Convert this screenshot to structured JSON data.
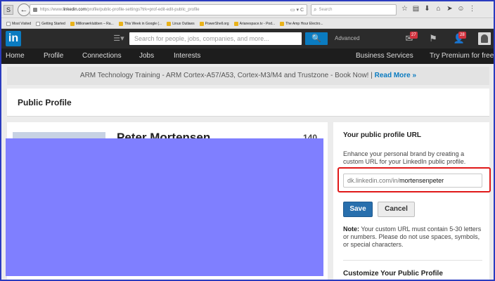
{
  "browser": {
    "s_badge": "S",
    "back_glyph": "←",
    "url_prefix": "https://www.",
    "url_domain": "linkedin.com",
    "url_path": "/profile/public-profile-settings?trk=prof-edit-edit-public_profile",
    "url_right": "▭ ▾ C",
    "search_placeholder": "Search",
    "toolbar_icons": [
      "☆",
      "▤",
      "⬇",
      "⌂",
      "➤",
      "☺",
      "⋮"
    ]
  },
  "bookmarks": [
    {
      "label": "Most Visited",
      "page": true
    },
    {
      "label": "Getting Started",
      "page": true
    },
    {
      "label": "Millionærklubben – Ra...",
      "page": false
    },
    {
      "label": "This Week in Google (...",
      "page": false
    },
    {
      "label": "Linux Outlaws",
      "page": false
    },
    {
      "label": "PowerShell.org",
      "page": false
    },
    {
      "label": "Arianespace.tv - Pod...",
      "page": false
    },
    {
      "label": "The Amp Hour Electro...",
      "page": false
    }
  ],
  "header": {
    "logo": "in",
    "menu_glyph": "☰▾",
    "search_placeholder": "Search for people, jobs, companies, and more...",
    "search_glyph": "🔍",
    "advanced": "Advanced",
    "messages_badge": "27",
    "notifications_badge": "28",
    "icon_messages": "✉",
    "icon_flag": "⚑",
    "icon_people": "👤"
  },
  "nav": {
    "home": "Home",
    "profile": "Profile",
    "connections": "Connections",
    "jobs": "Jobs",
    "interests": "Interests",
    "business": "Business Services",
    "premium": "Try Premium for free"
  },
  "ad": {
    "text": "ARM Technology Training - ARM Cortex-A57/A53, Cortex-M3/M4 and Trustzone - Book Now! | ",
    "link": "Read More »"
  },
  "page": {
    "title": "Public Profile"
  },
  "profile": {
    "name": "Peter Mortensen",
    "connections": "140"
  },
  "public_url": {
    "title": "Your public profile URL",
    "description": "Enhance your personal brand by creating a custom URL for your LinkedIn public profile.",
    "url_prefix": "dk.linkedin.com/in/",
    "url_slug": "mortensenpeter",
    "save_label": "Save",
    "cancel_label": "Cancel",
    "note_label": "Note:",
    "note_text": " Your custom URL must contain 5-30 letters or numbers. Please do not use spaces, symbols, or special characters.",
    "next_section": "Customize Your Public Profile"
  },
  "colors": {
    "accent": "#0a7bc0",
    "redaction": "#7f7fff",
    "highlight": "#e01818"
  }
}
